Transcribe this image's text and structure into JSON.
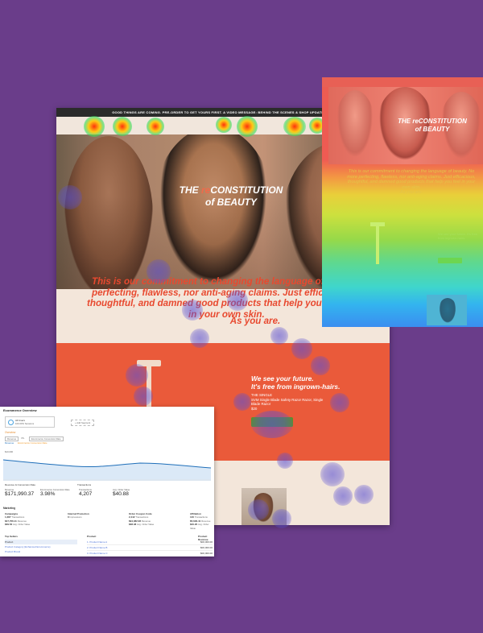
{
  "main": {
    "announcement": "GOOD THINGS ARE COMING. PRE-ORDER TO GET YOURS FIRST. A VIDEO MESSAGE: BEHIND THE SCENES & SHOP UPDATE LIVE!",
    "hero_title_prefix": "THE ",
    "hero_title_accent": "re",
    "hero_title_rest": "CONSTITUTION",
    "hero_title_line2": "of BEAUTY",
    "mission_lines": [
      "This is our commitment to changing the language of bea",
      "perfecting, flawless, nor anti-aging claims. Just effica",
      "thoughtful, and damned good products that help you fee",
      "in your own skin."
    ],
    "mission_tag": "As you are.",
    "future_line1": "We see your future.",
    "future_line2": "It's free from ingrown-hairs.",
    "product_name": "THE SINGLE",
    "product_desc": "SVM Single Blade Safety Razor Razor, Single Blade Razor",
    "product_price": "$20"
  },
  "heat_page": {
    "title_line1": "THE reCONSTITUTION",
    "title_line2": "of BEAUTY",
    "mission_text": "This is our commitment to changing the language of beauty. No more perfecting, flawless, nor anti-aging claims. Just efficacious, thoughtful, and damned good products that help you feel in your own skin.",
    "mission_tag": "As you are.",
    "future_text": "We see your future. It's free from ingrown-hairs."
  },
  "analytics": {
    "title": "Ecommerce Overview",
    "all_users": "All Users",
    "all_users_sub": "100.00% Sessions",
    "add_segment": "+ Add Segment",
    "overview_label": "Overview",
    "metric_select": "Revenue",
    "vs_label": "VS.",
    "metric_select2": "Ecommerce Conversion Rate",
    "legend": [
      "Revenue",
      "Ecommerce Conversion Rate"
    ],
    "y_labels": [
      "$10,000",
      "$5,000"
    ],
    "section_revenue": "Revenue & Conversion Rate",
    "section_transactions": "Transactions",
    "stats": [
      {
        "label": "Revenue",
        "value": "$171,990.37"
      },
      {
        "label": "Ecommerce Conversion Rate",
        "value": "3.98%"
      },
      {
        "label": "Transactions",
        "value": "4,207"
      },
      {
        "label": "Avg. Order Value",
        "value": "$40.88"
      }
    ],
    "marketing": "Marketing",
    "mkt_cols": [
      {
        "head": "Campaigns",
        "v1": "1,287",
        "s1": "Transactions",
        "v2": "$47,706.11",
        "s2": "Revenue",
        "v3": "$39.52",
        "s3": "Avg. Order Value"
      },
      {
        "head": "Internal Promotion",
        "v1": "0",
        "s1": "Impressions",
        "v2": "",
        "s2": "",
        "v3": "",
        "s3": ""
      },
      {
        "head": "Order Coupon Code",
        "v1": "2,442",
        "s1": "Transactions",
        "v2": "$94,082.08",
        "s2": "Revenue",
        "v3": "$38.48",
        "s3": "Avg. Order Value"
      },
      {
        "head": "Affiliation",
        "v1": "140",
        "s1": "Transactions",
        "v2": "$5,629.41",
        "s2": "Revenue",
        "v3": "$40.20",
        "s3": "Avg. Order Value"
      }
    ],
    "top_sellers": "Top Sellers",
    "col_product": "Product",
    "col_revenue": "Product Revenue",
    "left_items": [
      "Product",
      "Product Category (Enhanced Ecommerce)",
      "Product Brand"
    ],
    "products": [
      "1. Product Name A",
      "2. Product Name B",
      "3. Product Name C"
    ],
    "revenues": [
      "$00,000.00",
      "$00,000.00",
      "$00,000.00"
    ]
  }
}
